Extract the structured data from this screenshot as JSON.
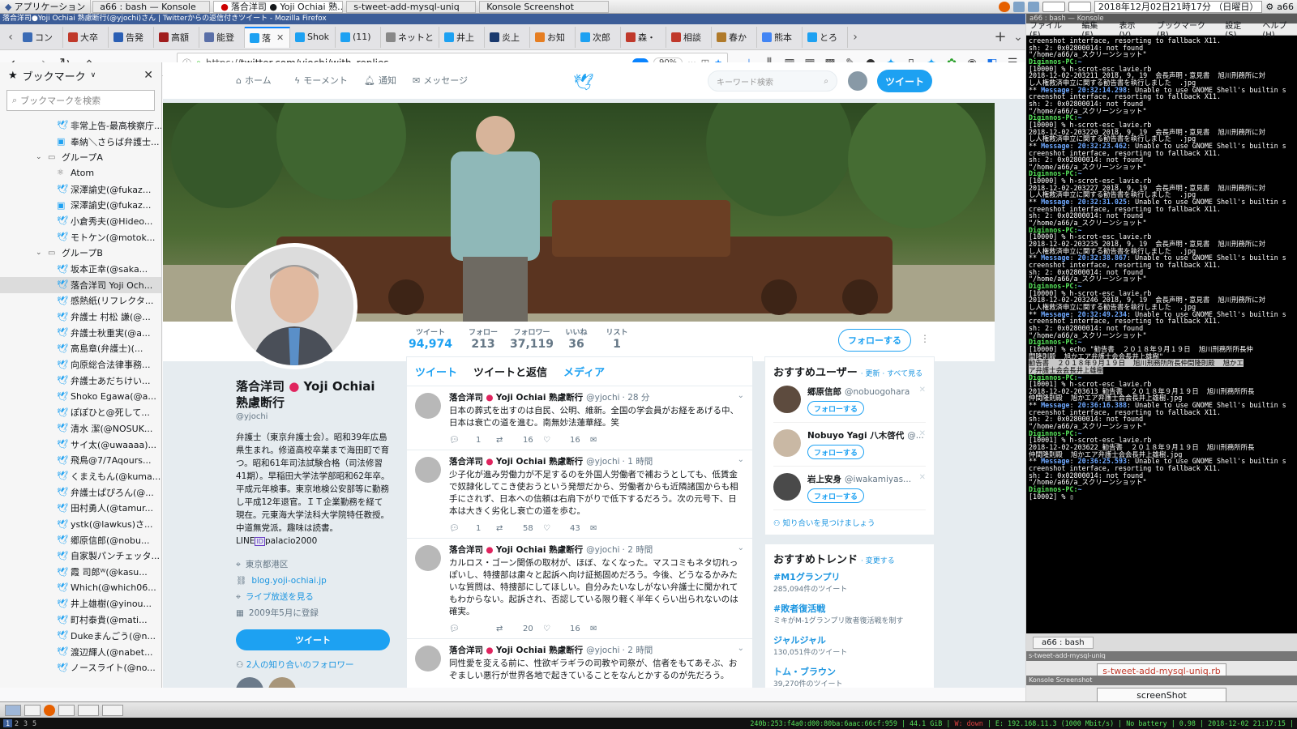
{
  "sysbar": {
    "app_menu": "アプリケーション",
    "tasks": [
      {
        "label": "a66 : bash — Konsole"
      },
      {
        "label": "落合洋司 ● Yoji Ochiai 熟..."
      },
      {
        "label": "s-tweet-add-mysql-uniq"
      },
      {
        "label": "Konsole Screenshot"
      }
    ],
    "clock": "2018年12月02日21時17分 （日曜日）",
    "user": "a66"
  },
  "firefox": {
    "window_title": "落合洋司●Yoji Ochiai 熟慮断行(@yjochi)さん | Twitterからの返信付きツイート - Mozilla Firefox",
    "tabs": [
      {
        "label": "コン",
        "color": "#3b6bb5"
      },
      {
        "label": "大卒",
        "color": "#c0392b"
      },
      {
        "label": "告発",
        "color": "#2b5fb4"
      },
      {
        "label": "高額",
        "color": "#a01d1d"
      },
      {
        "label": "能登",
        "color": "#5a6fa8"
      },
      {
        "label": "落",
        "color": "#1da1f2"
      },
      {
        "label": "Shok",
        "color": "#1da1f2"
      },
      {
        "label": "(11)",
        "color": "#1da1f2"
      },
      {
        "label": "ネットと",
        "color": "#888888"
      },
      {
        "label": "井上",
        "color": "#1da1f2"
      },
      {
        "label": "炎上",
        "color": "#1a3a6e"
      },
      {
        "label": "お知",
        "color": "#e67e22"
      },
      {
        "label": "次郎",
        "color": "#1da1f2"
      },
      {
        "label": "森・",
        "color": "#c0392b"
      },
      {
        "label": "相談",
        "color": "#c0392b"
      },
      {
        "label": "春か",
        "color": "#b07a2a"
      },
      {
        "label": "熊本",
        "color": "#4285f4"
      },
      {
        "label": "とろ",
        "color": "#1da1f2"
      }
    ],
    "url_prefix": "https://",
    "url_main": "twitter.com/yjochi/with_replies",
    "zoom": "90%"
  },
  "bookmarks": {
    "title": "ブックマーク",
    "search_placeholder": "ブックマークを検索",
    "items": [
      {
        "label": "非常上告-最高検察庁...",
        "kind": "twitter",
        "indent": 2
      },
      {
        "label": "奉納＼さらば弁護士...",
        "kind": "other",
        "indent": 2
      },
      {
        "label": "グループA",
        "kind": "folder",
        "indent": 1
      },
      {
        "label": "Atom",
        "kind": "atom",
        "indent": 2
      },
      {
        "label": "深澤諭史(@fukaz...",
        "kind": "twitter",
        "indent": 2
      },
      {
        "label": "深澤諭史(@fukaz...",
        "kind": "other",
        "indent": 2
      },
      {
        "label": "小倉秀夫(@Hideo...",
        "kind": "twitter",
        "indent": 2
      },
      {
        "label": "モトケン(@motok...",
        "kind": "twitter",
        "indent": 2
      },
      {
        "label": "グループB",
        "kind": "folder",
        "indent": 1
      },
      {
        "label": "坂本正幸(@saka...",
        "kind": "twitter",
        "indent": 2
      },
      {
        "label": "落合洋司 Yoji Och...",
        "kind": "twitter",
        "indent": 2,
        "selected": true
      },
      {
        "label": "感熱紙(リフレクタ...",
        "kind": "twitter",
        "indent": 2
      },
      {
        "label": "弁護士 村松 謙(@...",
        "kind": "twitter",
        "indent": 2
      },
      {
        "label": "弁護士秋重実(@a...",
        "kind": "twitter",
        "indent": 2
      },
      {
        "label": "高島章(弁護士)(...",
        "kind": "twitter",
        "indent": 2
      },
      {
        "label": "向原総合法律事務...",
        "kind": "twitter",
        "indent": 2
      },
      {
        "label": "弁護士あだちけい...",
        "kind": "twitter",
        "indent": 2
      },
      {
        "label": "Shoko Egawa(@a...",
        "kind": "twitter",
        "indent": 2
      },
      {
        "label": "ぽぽひと@死して...",
        "kind": "twitter",
        "indent": 2
      },
      {
        "label": "清水 潔(@NOSUK...",
        "kind": "twitter",
        "indent": 2
      },
      {
        "label": "サイ太(@uwaaaa)...",
        "kind": "twitter",
        "indent": 2
      },
      {
        "label": "飛鳥@7/7Aqours...",
        "kind": "twitter",
        "indent": 2
      },
      {
        "label": "くまえもん(@kuma...",
        "kind": "twitter",
        "indent": 2
      },
      {
        "label": "弁護士ぱぴろん(@...",
        "kind": "twitter",
        "indent": 2
      },
      {
        "label": "田村勇人(@tamur...",
        "kind": "twitter",
        "indent": 2
      },
      {
        "label": "ystk(@lawkus)さ...",
        "kind": "twitter",
        "indent": 2
      },
      {
        "label": "郷原信郎(@nobu...",
        "kind": "twitter",
        "indent": 2
      },
      {
        "label": "自家製パンチェッタ...",
        "kind": "twitter",
        "indent": 2
      },
      {
        "label": "霞 司郎ᵂ(@kasu...",
        "kind": "twitter",
        "indent": 2
      },
      {
        "label": "Which(@which06...",
        "kind": "twitter",
        "indent": 2
      },
      {
        "label": "井上雄樹(@yinou...",
        "kind": "twitter",
        "indent": 2
      },
      {
        "label": "町村泰貴(@mati...",
        "kind": "twitter",
        "indent": 2
      },
      {
        "label": "Dukeまんごう(@n...",
        "kind": "twitter",
        "indent": 2
      },
      {
        "label": "渡辺輝人(@nabet...",
        "kind": "twitter",
        "indent": 2
      },
      {
        "label": "ノースライト(@no...",
        "kind": "twitter",
        "indent": 2
      }
    ]
  },
  "twitter": {
    "nav": {
      "home": "ホーム",
      "moments": "モーメント",
      "notifications": "通知",
      "messages": "メッセージ",
      "search_placeholder": "キーワード検索",
      "tweet_button": "ツイート"
    },
    "stats": [
      {
        "label": "ツイート",
        "value": "94,974"
      },
      {
        "label": "フォロー",
        "value": "213"
      },
      {
        "label": "フォロワー",
        "value": "37,119"
      },
      {
        "label": "いいね",
        "value": "36"
      },
      {
        "label": "リスト",
        "value": "1"
      }
    ],
    "follow_button": "フォローする",
    "profile": {
      "name_part1": "落合洋司 ",
      "name_dot": "●",
      "name_part2": " Yoji Ochiai 熟慮断行",
      "handle": "@yjochi",
      "bio": "弁護士（東京弁護士会）。昭和39年広島県生まれ。修道高校卒業まで海田町で育つ。昭和61年司法試験合格（司法修習41期）。早稲田大学法学部昭和62年卒。平成元年検事。東京地検公安部等に勤務し平成12年退官。ＩＴ企業勤務を経て現在。元東海大学法科大学院特任教授。中道無党派。趣味は読書。LINE",
      "bio_line_id": "palacio2000",
      "location": "東京都港区",
      "website": "blog.yoji-ochiai.jp",
      "live": "ライブ放送を見る",
      "joined": "2009年5月に登録",
      "tweet_button": "ツイート",
      "mutual_followers": "2人の知り合いのフォロワー"
    },
    "timeline_tabs": [
      "ツイート",
      "ツイートと返信",
      "メディア"
    ],
    "tweets": [
      {
        "name": "落合洋司",
        "name2": "Yoji Ochiai 熟慮断行",
        "handle": "@yjochi",
        "time": "· 28 分",
        "text": "日本の葬式を出すのは自民、公明、維新。全国の学会員がお経をあげる中、日本は衰亡の道を進む。南無妙法蓮華経。笑",
        "replies": "1",
        "retweets": "16",
        "likes": "16"
      },
      {
        "name": "落合洋司",
        "name2": "Yoji Ochiai 熟慮断行",
        "handle": "@yjochi",
        "time": "· 1 時間",
        "text": "少子化が進み労働力が不足するのを外国人労働者で補おうとしても、低賃金で奴隷化してこき使おうという発想だから、労働者からも近隣諸国からも相手にされず、日本への信頼は右肩下がりで低下するだろう。次の元号下、日本は大きく劣化し衰亡の道を歩む。",
        "replies": "1",
        "retweets": "58",
        "likes": "43"
      },
      {
        "name": "落合洋司",
        "name2": "Yoji Ochiai 熟慮断行",
        "handle": "@yjochi",
        "time": "· 2 時間",
        "text": "カルロス・ゴーン関係の取材が、ほぼ、なくなった。マスコミもネタ切れっぽいし、特捜部は粛々と起訴へ向け証拠固めだろう。今後、どうなるかみたいな質問は、特捜部にしてほしい。自分みたいなしがない弁護士に聞かれてもわからない。起訴され、否認している限り軽く半年くらい出られないのは確実。",
        "replies": "",
        "retweets": "20",
        "likes": "16"
      },
      {
        "name": "落合洋司",
        "name2": "Yoji Ochiai 熟慮断行",
        "handle": "@yjochi",
        "time": "· 2 時間",
        "text": "同性愛を変える前に、性欲ギラギラの司教や司祭が、信者をもてあそぶ、おぞましい悪行が世界各地で起きていることをなんとかするのが先だろう。",
        "replies": "",
        "retweets": "",
        "likes": ""
      }
    ],
    "suggested": {
      "title": "おすすめユーザー",
      "links": "· 更新 · すべて見る",
      "users": [
        {
          "name": "郷原信郎",
          "handle": "@nobuogohara",
          "button": "フォローする"
        },
        {
          "name": "Nobuyo Yagi 八木啓代",
          "handle": "@...",
          "button": "フォローする"
        },
        {
          "name": "岩上安身",
          "handle": "@iwakamiyas...",
          "button": "フォローする"
        }
      ],
      "find_friends": "知り合いを見つけましょう"
    },
    "trends": {
      "title": "おすすめトレンド",
      "change": "· 変更する",
      "items": [
        {
          "name": "#M1グランプリ",
          "count": "285,094件のツイート"
        },
        {
          "name": "#敗者復活戦",
          "count": "ミキがM-1グランプリ敗者復活戦を制す"
        },
        {
          "name": "ジャルジャル",
          "count": "130,051件のツイート"
        },
        {
          "name": "トム・ブラウン",
          "count": "39,270件のツイート"
        },
        {
          "name": "ギャロップ",
          "count": ""
        }
      ]
    }
  },
  "konsole": {
    "title": "a66 : bash — Konsole",
    "menu": [
      "ファイル(F)",
      "編集(E)",
      "表示(V)",
      "ブックマーク(B)",
      "設定(S)",
      "ヘルプ(H)"
    ],
    "tab_label": "a66 : bash",
    "panel2_title": "s-tweet-add-mysql-uniq",
    "panel2_button": "s-tweet-add-mysql-uniq.rb",
    "panel3_title": "Konsole Screenshot",
    "panel3_button": "screenShot"
  },
  "statusbar": {
    "workspaces": [
      "1",
      "2",
      "3",
      "5"
    ],
    "status_text": "240b:253:f4a0:d00:80ba:6aac:66cf:959 | 44.1 GiB |",
    "status_red": "W: down",
    "status_rest": "| E: 192.168.11.3 (1000 Mbit/s) | No battery | 0.98 | 2018-12-02 21:17:15 |"
  }
}
